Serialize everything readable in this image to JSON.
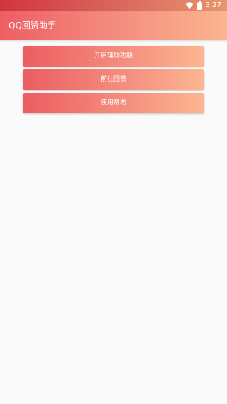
{
  "status_bar": {
    "time": "3:27",
    "icons": [
      "wifi-icon",
      "battery-icon"
    ]
  },
  "app_bar": {
    "title": "QQ回赞助手"
  },
  "actions": [
    {
      "label": "开启辅助功能"
    },
    {
      "label": "前往回赞"
    },
    {
      "label": "使用帮助"
    }
  ],
  "colors": {
    "status_bar": "#d86b60",
    "gradient_start": "#ec5d61",
    "gradient_end": "#fcb690",
    "background": "#fafafa",
    "text_on_accent": "#ffffff"
  }
}
